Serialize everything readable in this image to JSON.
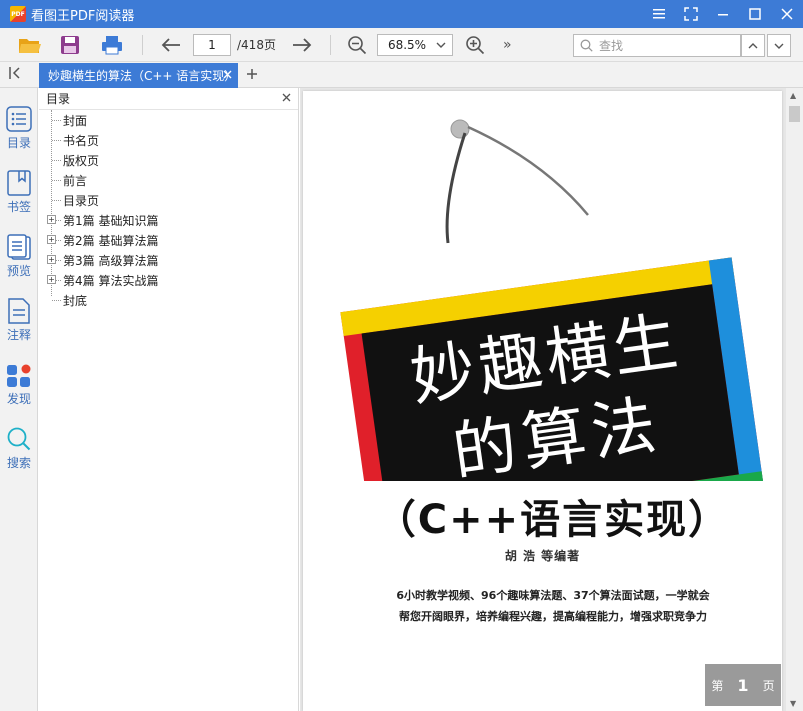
{
  "window": {
    "title": "看图王PDF阅读器",
    "logo_text": "PDF"
  },
  "toolbar": {
    "current_page": "1",
    "total_pages": "/418页",
    "zoom": "68.5%",
    "search_placeholder": "查找"
  },
  "tabs": [
    {
      "label": "妙趣横生的算法（C++ 语言实现）"
    }
  ],
  "sidebar": {
    "items": [
      {
        "label": "目录",
        "icon": "list-icon"
      },
      {
        "label": "书签",
        "icon": "bookmark-icon"
      },
      {
        "label": "预览",
        "icon": "thumbnail-icon"
      },
      {
        "label": "注释",
        "icon": "note-icon"
      },
      {
        "label": "发现",
        "icon": "discover-icon"
      },
      {
        "label": "搜索",
        "icon": "search-icon"
      }
    ]
  },
  "toc": {
    "title": "目录",
    "items": [
      {
        "label": "封面",
        "expandable": false
      },
      {
        "label": "书名页",
        "expandable": false
      },
      {
        "label": "版权页",
        "expandable": false
      },
      {
        "label": "前言",
        "expandable": false
      },
      {
        "label": "目录页",
        "expandable": false
      },
      {
        "label": "第1篇 基础知识篇",
        "expandable": true
      },
      {
        "label": "第2篇 基础算法篇",
        "expandable": true
      },
      {
        "label": "第3篇 高级算法篇",
        "expandable": true
      },
      {
        "label": "第4篇 算法实战篇",
        "expandable": true
      },
      {
        "label": "封底",
        "expandable": false
      }
    ]
  },
  "cover": {
    "title_line1": "妙趣横生",
    "title_line2": "的算法",
    "subtitle": "（C++语言实现）",
    "author": "胡  浩    等编著",
    "desc_line1": "6小时教学视频、96个趣味算法题、37个算法面试题，一学就会",
    "desc_line2": "帮您开阔眼界，培养编程兴趣，提高编程能力，增强求职竞争力"
  },
  "page_indicator": {
    "prefix": "第",
    "number": "1",
    "suffix": "页"
  },
  "colors": {
    "accent": "#3d7bd6",
    "board": "#111111",
    "yellow": "#f5d000",
    "blue": "#1e8fdc",
    "green": "#1aa84a",
    "red": "#e0202a"
  }
}
